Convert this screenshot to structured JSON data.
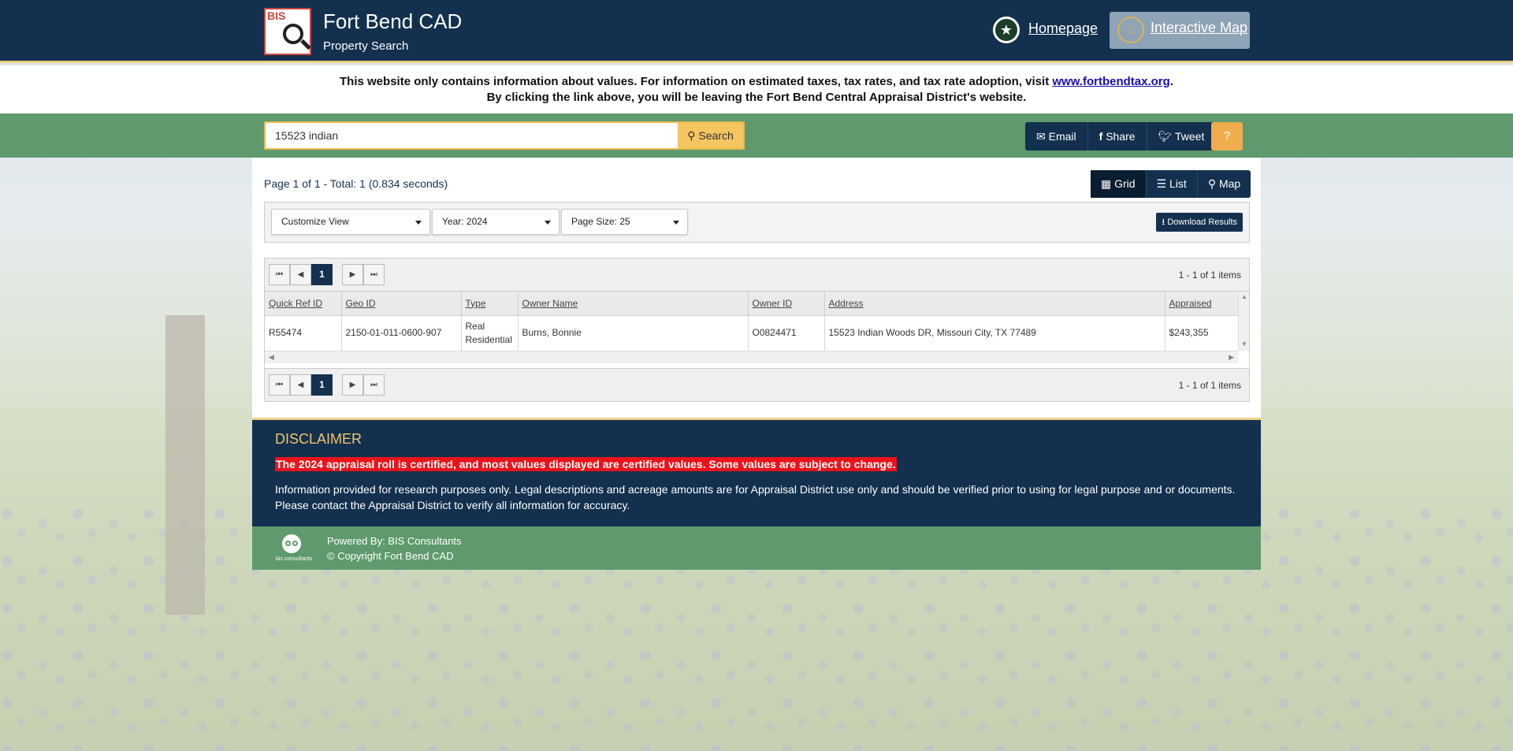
{
  "header": {
    "logo_text": "BIS",
    "title": "Fort Bend CAD",
    "subtitle": "Property Search",
    "home_link": "Homepage",
    "map_link": "Interactive Map"
  },
  "notice": {
    "line1_prefix": "This website only contains information about values. For information on estimated taxes, tax rates, and tax rate adoption, visit ",
    "line1_link": "www.fortbendtax.org",
    "line1_suffix": ".",
    "line2": "By clicking the link above, you will be leaving the Fort Bend Central Appraisal District's website."
  },
  "search": {
    "value": "15523 indian",
    "button_label": "Search"
  },
  "share": {
    "email": "Email",
    "share": "Share",
    "tweet": "Tweet",
    "help": "?"
  },
  "results": {
    "page_info": "Page 1 of 1 - Total: 1 (0.834 seconds)",
    "views": {
      "grid": "Grid",
      "list": "List",
      "map": "Map",
      "active": "grid"
    },
    "customize_view": "Customize View",
    "year": "Year: 2024",
    "page_size": "Page Size: 25",
    "download": "Download Results",
    "pager": {
      "current_page": "1",
      "items_info": "1 - 1 of 1 items"
    },
    "columns": [
      "Quick Ref ID",
      "Geo ID",
      "Type",
      "Owner Name",
      "Owner ID",
      "Address",
      "Appraised"
    ],
    "rows": [
      {
        "quick_ref_id": "R55474",
        "geo_id": "2150-01-011-0600-907",
        "type_line1": "Real",
        "type_line2": "Residential",
        "owner_name": "Burns, Bonnie",
        "owner_id": "O0824471",
        "address": "15523 Indian Woods DR, Missouri City, TX 77489",
        "appraised": "$243,355"
      }
    ]
  },
  "disclaimer": {
    "title": "DISCLAIMER",
    "highlight": "The 2024 appraisal roll is certified, and most values displayed are certified values.  Some values are subject to change.",
    "text": "Information provided for research purposes only. Legal descriptions and acreage amounts are for Appraisal District use only and should be verified prior to using for legal purpose and or documents. Please contact the Appraisal District to verify all information for accuracy."
  },
  "footer": {
    "logo_text": "bis consultants",
    "powered_by": "Powered By: BIS Consultants",
    "copyright": "© Copyright Fort Bend CAD"
  },
  "colors": {
    "navy": "#13304e",
    "green": "#5e9a6d",
    "gold": "#f0c66a",
    "alert_red": "#e8141a"
  }
}
